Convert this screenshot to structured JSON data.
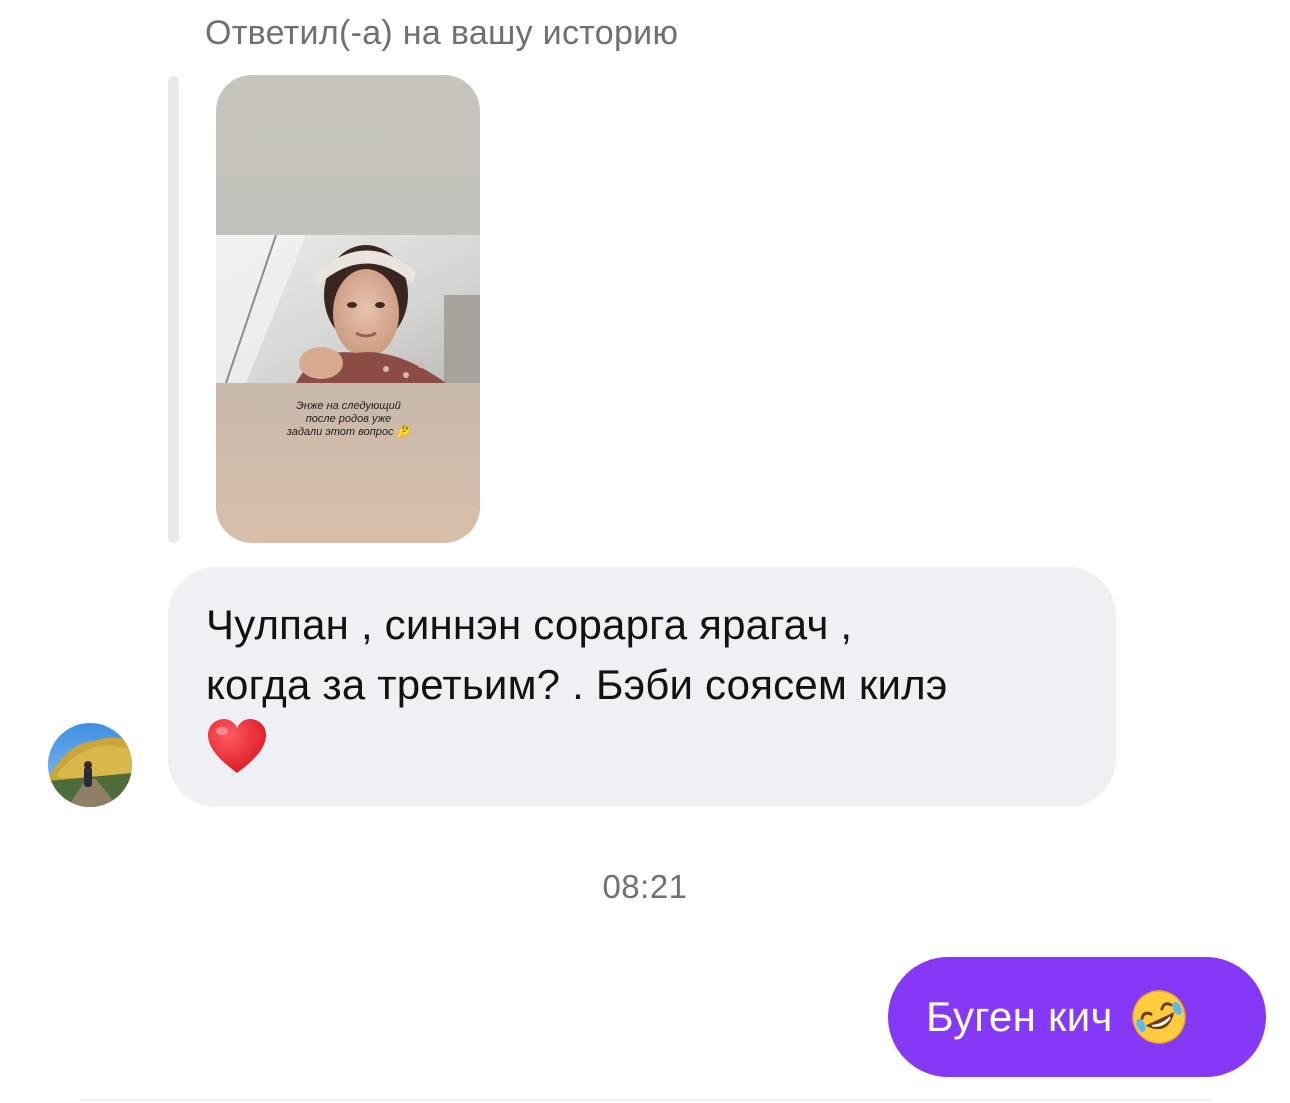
{
  "reply_context": {
    "label": "Ответил(-а) на вашу историю",
    "story_caption": "Энже на следующий\nпосле родов уже\nзадали этот вопрос 🤔"
  },
  "messages": [
    {
      "direction": "incoming",
      "text": "Чулпан , синнэн сорарга ярагач ,\nкогда за третьим? . Бэби соясем килэ",
      "emoji": "heart-emoji"
    },
    {
      "direction": "outgoing",
      "text": "Буген кич",
      "emoji": "rolling-on-floor-laughing-emoji"
    }
  ],
  "timestamp": "08:21",
  "colors": {
    "incoming_bubble": "#eff0f3",
    "outgoing_bubble": "#8538f6",
    "secondary_text": "#6e7077"
  }
}
